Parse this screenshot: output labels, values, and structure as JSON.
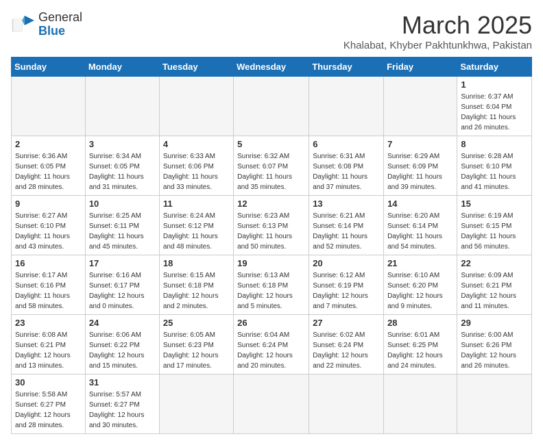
{
  "header": {
    "logo_text_normal": "General",
    "logo_text_bold": "Blue",
    "month_title": "March 2025",
    "location": "Khalabat, Khyber Pakhtunkhwa, Pakistan"
  },
  "weekdays": [
    "Sunday",
    "Monday",
    "Tuesday",
    "Wednesday",
    "Thursday",
    "Friday",
    "Saturday"
  ],
  "weeks": [
    [
      {
        "day": "",
        "info": ""
      },
      {
        "day": "",
        "info": ""
      },
      {
        "day": "",
        "info": ""
      },
      {
        "day": "",
        "info": ""
      },
      {
        "day": "",
        "info": ""
      },
      {
        "day": "",
        "info": ""
      },
      {
        "day": "1",
        "info": "Sunrise: 6:37 AM\nSunset: 6:04 PM\nDaylight: 11 hours\nand 26 minutes."
      }
    ],
    [
      {
        "day": "2",
        "info": "Sunrise: 6:36 AM\nSunset: 6:05 PM\nDaylight: 11 hours\nand 28 minutes."
      },
      {
        "day": "3",
        "info": "Sunrise: 6:34 AM\nSunset: 6:05 PM\nDaylight: 11 hours\nand 31 minutes."
      },
      {
        "day": "4",
        "info": "Sunrise: 6:33 AM\nSunset: 6:06 PM\nDaylight: 11 hours\nand 33 minutes."
      },
      {
        "day": "5",
        "info": "Sunrise: 6:32 AM\nSunset: 6:07 PM\nDaylight: 11 hours\nand 35 minutes."
      },
      {
        "day": "6",
        "info": "Sunrise: 6:31 AM\nSunset: 6:08 PM\nDaylight: 11 hours\nand 37 minutes."
      },
      {
        "day": "7",
        "info": "Sunrise: 6:29 AM\nSunset: 6:09 PM\nDaylight: 11 hours\nand 39 minutes."
      },
      {
        "day": "8",
        "info": "Sunrise: 6:28 AM\nSunset: 6:10 PM\nDaylight: 11 hours\nand 41 minutes."
      }
    ],
    [
      {
        "day": "9",
        "info": "Sunrise: 6:27 AM\nSunset: 6:10 PM\nDaylight: 11 hours\nand 43 minutes."
      },
      {
        "day": "10",
        "info": "Sunrise: 6:25 AM\nSunset: 6:11 PM\nDaylight: 11 hours\nand 45 minutes."
      },
      {
        "day": "11",
        "info": "Sunrise: 6:24 AM\nSunset: 6:12 PM\nDaylight: 11 hours\nand 48 minutes."
      },
      {
        "day": "12",
        "info": "Sunrise: 6:23 AM\nSunset: 6:13 PM\nDaylight: 11 hours\nand 50 minutes."
      },
      {
        "day": "13",
        "info": "Sunrise: 6:21 AM\nSunset: 6:14 PM\nDaylight: 11 hours\nand 52 minutes."
      },
      {
        "day": "14",
        "info": "Sunrise: 6:20 AM\nSunset: 6:14 PM\nDaylight: 11 hours\nand 54 minutes."
      },
      {
        "day": "15",
        "info": "Sunrise: 6:19 AM\nSunset: 6:15 PM\nDaylight: 11 hours\nand 56 minutes."
      }
    ],
    [
      {
        "day": "16",
        "info": "Sunrise: 6:17 AM\nSunset: 6:16 PM\nDaylight: 11 hours\nand 58 minutes."
      },
      {
        "day": "17",
        "info": "Sunrise: 6:16 AM\nSunset: 6:17 PM\nDaylight: 12 hours\nand 0 minutes."
      },
      {
        "day": "18",
        "info": "Sunrise: 6:15 AM\nSunset: 6:18 PM\nDaylight: 12 hours\nand 2 minutes."
      },
      {
        "day": "19",
        "info": "Sunrise: 6:13 AM\nSunset: 6:18 PM\nDaylight: 12 hours\nand 5 minutes."
      },
      {
        "day": "20",
        "info": "Sunrise: 6:12 AM\nSunset: 6:19 PM\nDaylight: 12 hours\nand 7 minutes."
      },
      {
        "day": "21",
        "info": "Sunrise: 6:10 AM\nSunset: 6:20 PM\nDaylight: 12 hours\nand 9 minutes."
      },
      {
        "day": "22",
        "info": "Sunrise: 6:09 AM\nSunset: 6:21 PM\nDaylight: 12 hours\nand 11 minutes."
      }
    ],
    [
      {
        "day": "23",
        "info": "Sunrise: 6:08 AM\nSunset: 6:21 PM\nDaylight: 12 hours\nand 13 minutes."
      },
      {
        "day": "24",
        "info": "Sunrise: 6:06 AM\nSunset: 6:22 PM\nDaylight: 12 hours\nand 15 minutes."
      },
      {
        "day": "25",
        "info": "Sunrise: 6:05 AM\nSunset: 6:23 PM\nDaylight: 12 hours\nand 17 minutes."
      },
      {
        "day": "26",
        "info": "Sunrise: 6:04 AM\nSunset: 6:24 PM\nDaylight: 12 hours\nand 20 minutes."
      },
      {
        "day": "27",
        "info": "Sunrise: 6:02 AM\nSunset: 6:24 PM\nDaylight: 12 hours\nand 22 minutes."
      },
      {
        "day": "28",
        "info": "Sunrise: 6:01 AM\nSunset: 6:25 PM\nDaylight: 12 hours\nand 24 minutes."
      },
      {
        "day": "29",
        "info": "Sunrise: 6:00 AM\nSunset: 6:26 PM\nDaylight: 12 hours\nand 26 minutes."
      }
    ],
    [
      {
        "day": "30",
        "info": "Sunrise: 5:58 AM\nSunset: 6:27 PM\nDaylight: 12 hours\nand 28 minutes."
      },
      {
        "day": "31",
        "info": "Sunrise: 5:57 AM\nSunset: 6:27 PM\nDaylight: 12 hours\nand 30 minutes."
      },
      {
        "day": "",
        "info": ""
      },
      {
        "day": "",
        "info": ""
      },
      {
        "day": "",
        "info": ""
      },
      {
        "day": "",
        "info": ""
      },
      {
        "day": "",
        "info": ""
      }
    ]
  ]
}
